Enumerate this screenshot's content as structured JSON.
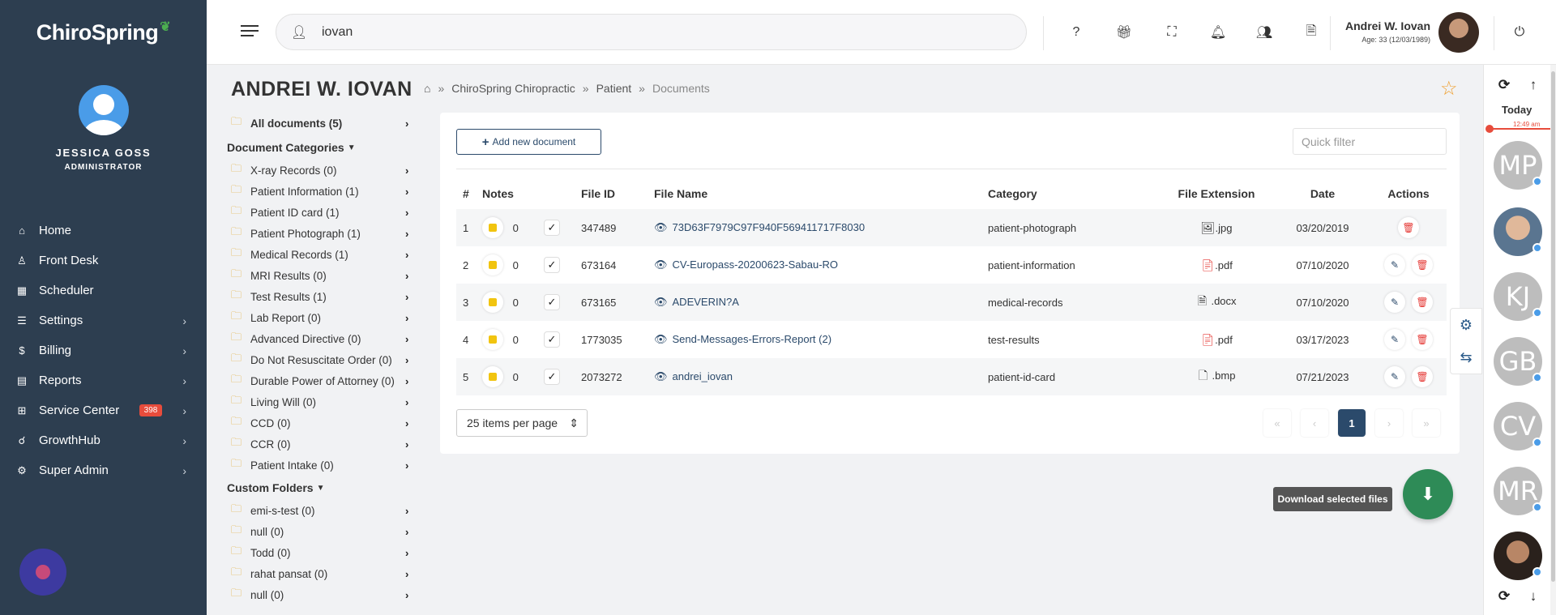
{
  "sidebar": {
    "logo": "ChiroSpring",
    "user_name": "JESSICA GOSS",
    "user_role": "ADMINISTRATOR",
    "menu": [
      {
        "label": "Home",
        "icon": "home-icon",
        "glyph": "⌂",
        "chevron": false
      },
      {
        "label": "Front Desk",
        "icon": "user-desk-icon",
        "glyph": "♙",
        "chevron": false
      },
      {
        "label": "Scheduler",
        "icon": "calendar-icon",
        "glyph": "▦",
        "chevron": false
      },
      {
        "label": "Settings",
        "icon": "sliders-icon",
        "glyph": "☰",
        "chevron": true
      },
      {
        "label": "Billing",
        "icon": "dollar-icon",
        "glyph": "$",
        "chevron": true
      },
      {
        "label": "Reports",
        "icon": "file-icon",
        "glyph": "▤",
        "chevron": true
      },
      {
        "label": "Service Center",
        "icon": "grid-icon",
        "glyph": "⊞",
        "chevron": true,
        "badge": "398"
      },
      {
        "label": "GrowthHub",
        "icon": "handshake-icon",
        "glyph": "☌",
        "chevron": true
      },
      {
        "label": "Super Admin",
        "icon": "cog-icon",
        "glyph": "⚙",
        "chevron": true
      }
    ]
  },
  "topbar": {
    "search_value": "iovan",
    "user_name": "Andrei W. Iovan",
    "user_age": "Age: 33 (12/03/1989)"
  },
  "page": {
    "title": "ANDREI W. IOVAN",
    "breadcrumb": [
      "ChiroSpring Chiropractic",
      "Patient",
      "Documents"
    ]
  },
  "tree": {
    "all_documents": "All documents (5)",
    "categories_header": "Document Categories",
    "categories": [
      "X-ray Records (0)",
      "Patient Information (1)",
      "Patient ID card (1)",
      "Patient Photograph (1)",
      "Medical Records (1)",
      "MRI Results (0)",
      "Test Results (1)",
      "Lab Report (0)",
      "Advanced Directive (0)",
      "Do Not Resuscitate Order (0)",
      "Durable Power of Attorney (0)",
      "Living Will (0)",
      "CCD (0)",
      "CCR (0)",
      "Patient Intake (0)"
    ],
    "custom_header": "Custom Folders",
    "custom": [
      "emi-s-test (0)",
      "null (0)",
      "Todd (0)",
      "rahat pansat (0)",
      "null (0)"
    ]
  },
  "documents": {
    "add_button": "Add new document",
    "quick_filter_placeholder": "Quick filter",
    "columns": [
      "#",
      "Notes",
      "",
      "File ID",
      "File Name",
      "Category",
      "File Extension",
      "Date",
      "Actions"
    ],
    "rows": [
      {
        "num": "1",
        "notes": "0",
        "file_id": "347489",
        "file_name": "73D63F7979C97F940F569411717F8030",
        "category": "patient-photograph",
        "ext": ".jpg",
        "ext_icon": "image-file-icon",
        "date": "03/20/2019",
        "editable": false
      },
      {
        "num": "2",
        "notes": "0",
        "file_id": "673164",
        "file_name": "CV-Europass-20200623-Sabau-RO",
        "category": "patient-information",
        "ext": ".pdf",
        "ext_icon": "pdf-file-icon",
        "date": "07/10/2020",
        "editable": true
      },
      {
        "num": "3",
        "notes": "0",
        "file_id": "673165",
        "file_name": "ADEVERIN?A",
        "category": "medical-records",
        "ext": ".docx",
        "ext_icon": "word-file-icon",
        "date": "07/10/2020",
        "editable": true
      },
      {
        "num": "4",
        "notes": "0",
        "file_id": "1773035",
        "file_name": "Send-Messages-Errors-Report (2)",
        "category": "test-results",
        "ext": ".pdf",
        "ext_icon": "pdf-file-icon",
        "date": "03/17/2023",
        "editable": true
      },
      {
        "num": "5",
        "notes": "0",
        "file_id": "2073272",
        "file_name": "andrei_iovan",
        "category": "patient-id-card",
        "ext": ".bmp",
        "ext_icon": "file-icon",
        "date": "07/21/2023",
        "editable": true
      }
    ],
    "per_page": "25 items per page",
    "pager": [
      "«",
      "‹",
      "1",
      "›",
      "»"
    ],
    "current_page": "1"
  },
  "download": {
    "tooltip": "Download selected files"
  },
  "right_panel": {
    "today_label": "Today",
    "time": "12:49 am",
    "avatars": [
      "MP",
      "",
      "KJ",
      "GB",
      "CV",
      "MR",
      ""
    ]
  },
  "colors": {
    "sidebar_bg": "#2d3e50",
    "primary": "#2b4a6b",
    "download_green": "#2e8b57",
    "badge_red": "#e74c3c",
    "folder_yellow": "#e2a92e"
  }
}
